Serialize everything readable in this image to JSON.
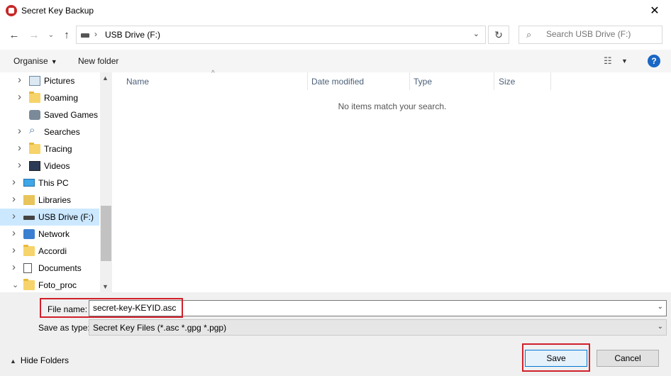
{
  "window": {
    "title": "Secret Key Backup",
    "close_glyph": "✕"
  },
  "nav": {
    "back_glyph": "←",
    "forward_glyph": "→",
    "recent_glyph": "⌄",
    "up_glyph": "↑",
    "address_separator": "›",
    "address_path": "USB Drive (F:)",
    "address_dropdown_glyph": "⌄",
    "refresh_glyph": "↻",
    "search_placeholder": "Search USB Drive (F:)"
  },
  "commands": {
    "organise": "Organise",
    "organise_caret": "▼",
    "new_folder": "New folder",
    "view_glyph": "☷",
    "view_caret": "▼",
    "help": "?"
  },
  "tree": [
    {
      "label": "Pictures",
      "icon": "pictures-icon",
      "level": 2,
      "expanded": false
    },
    {
      "label": "Roaming",
      "icon": "folder-icon",
      "level": 2,
      "expanded": false
    },
    {
      "label": "Saved Games",
      "icon": "saved-games-icon",
      "level": 2,
      "expanded": null
    },
    {
      "label": "Searches",
      "icon": "searches-icon",
      "level": 2,
      "expanded": false
    },
    {
      "label": "Tracing",
      "icon": "folder-icon",
      "level": 2,
      "expanded": false
    },
    {
      "label": "Videos",
      "icon": "videos-icon",
      "level": 2,
      "expanded": false
    },
    {
      "label": "This PC",
      "icon": "this-pc-icon",
      "level": 1,
      "expanded": false
    },
    {
      "label": "Libraries",
      "icon": "libraries-icon",
      "level": 1,
      "expanded": false
    },
    {
      "label": "USB Drive (F:)",
      "icon": "usb-drive-icon",
      "level": 1,
      "expanded": false,
      "selected": true
    },
    {
      "label": "Network",
      "icon": "network-icon",
      "level": 1,
      "expanded": false
    },
    {
      "label": "Accordi",
      "icon": "folder-icon",
      "level": 1,
      "expanded": false
    },
    {
      "label": "Documents",
      "icon": "documents-icon",
      "level": 1,
      "expanded": false
    },
    {
      "label": "Foto_proc",
      "icon": "folder-icon",
      "level": 1,
      "expanded": true
    }
  ],
  "columns": {
    "name": "Name",
    "date_modified": "Date modified",
    "type": "Type",
    "size": "Size",
    "sort_glyph": "^"
  },
  "empty_message": "No items match your search.",
  "form": {
    "file_name_label": "File name:",
    "file_name_value": "secret-key-KEYID.asc",
    "save_as_type_label": "Save as type:",
    "save_as_type_value": "Secret Key Files (*.asc *.gpg *.pgp)",
    "dropdown_glyph": "⌄"
  },
  "footer": {
    "hide_folders": "Hide Folders",
    "hide_folders_glyph": "▲",
    "save": "Save",
    "cancel": "Cancel"
  },
  "colors": {
    "highlight": "#d0202a",
    "selected_bg": "#cce8ff",
    "help_blue": "#1a66c4"
  }
}
